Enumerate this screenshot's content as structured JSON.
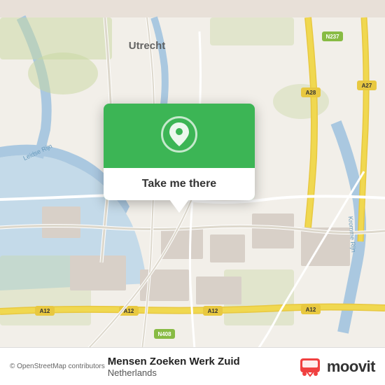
{
  "map": {
    "background_color": "#e8e0d8",
    "attribution": "© OpenStreetMap contributors"
  },
  "popup": {
    "button_label": "Take me there",
    "icon_name": "location-pin-icon"
  },
  "bottom_bar": {
    "location_name": "Mensen Zoeken Werk Zuid",
    "location_country": "Netherlands",
    "moovit_label": "moovit"
  }
}
